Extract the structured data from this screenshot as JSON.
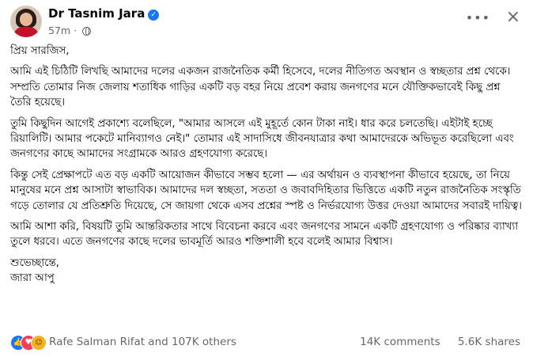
{
  "post": {
    "author": "Dr Tasnim Jara",
    "time": "57m",
    "privacy_icon": "globe-icon",
    "paragraphs": [
      "প্রিয় সারজিস,",
      "আমি এই চিঠিটি লিখছি আমাদের দলের একজন রাজনৈতিক কর্মী হিসেবে, দলের নীতিগত অবস্থান ও স্বচ্ছতার প্রশ্ন থেকে। সম্প্রতি তোমার নিজ জেলায় শতাধিক গাড়ির একটি বড় বহর নিয়ে প্রবেশ করায় জনগণের মনে যৌক্তিকভাবেই কিছু প্রশ্ন তৈরি হয়েছে।",
      "তুমি কিছুদিন আগেই প্রকাশ্যে বলেছিলে, \"আমার আসলে এই মুহূর্তে কোন টাকা নাই। ধার করে চলতেছি। এইটাই হচ্ছে রিয়ালিটি। আমার পকেটে মানিব্যাগও নেই।\" তোমার এই সাদাসিধে জীবনযাত্রার কথা আমাদেরকে অভিভূত করেছিলো এবং জনগণের কাছে আমাদের সংগ্রামকে আরও গ্রহণযোগ্য করেছে।",
      "কিন্তু সেই প্রেক্ষাপটে এত বড় একটি আয়োজন কীভাবে সম্ভব হলো — এর অর্থায়ন ও ব্যবস্থাপনা কীভাবে হয়েছে, তা নিয়ে মানুষের মনে প্রশ্ন আসাটা স্বাভাবিক। আমাদের দল স্বচ্ছতা, সততা ও জবাবদিহিতার ভিত্তিতে একটি নতুন রাজনৈতিক সংস্কৃতি গড়ে তোলার যে প্রতিশ্রুতি দিয়েছে, সে জায়গা থেকে এসব প্রশ্নের স্পষ্ট ও নির্ভরযোগ্য উত্তর দেওয়া আমাদের সবারই দায়িত্ব।",
      "আমি আশা করি, বিষয়টি তুমি আন্তরিকতার সাথে বিবেচনা করবে এবং জনগণের সামনে একটি গ্রহণযোগ্য ও পরিষ্কার ব্যাখ্যা তুলে ধরবে। এতে জনগণের কাছে দলের ভাবমূর্তি আরও শক্তিশালী হবে বলেই আমার বিশ্বাস।"
    ],
    "signoff": [
      "শুভেচ্ছান্তে,",
      "জারা আপু"
    ]
  },
  "footer": {
    "reactions": [
      "like",
      "love",
      "haha"
    ],
    "reacted_by": "Rafe Salman Rifat and 107K others",
    "comments": "14K comments",
    "shares": "5.6K shares"
  },
  "colors": {
    "verified": "#1877f2",
    "like": "#1877f2",
    "love": "#f33e58",
    "haha": "#f7b125"
  }
}
